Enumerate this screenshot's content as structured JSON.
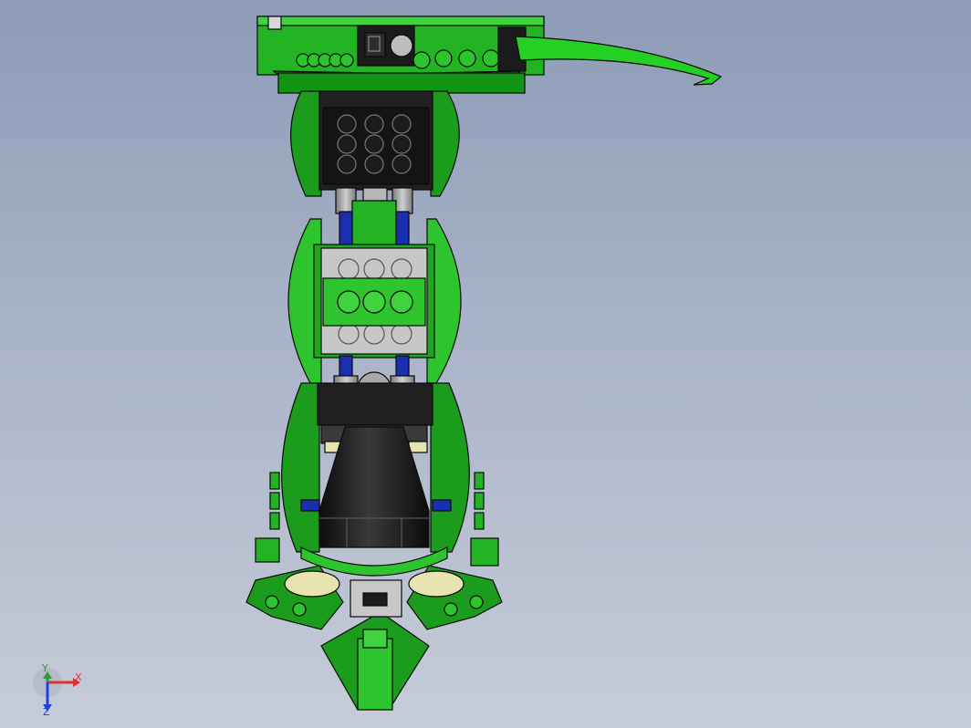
{
  "scene": {
    "view": "cad-3d-model-viewport",
    "subject": "lego-green-insect-creature",
    "colors": {
      "background_top": "#8d9bb6",
      "background_bottom": "#c6ccd8",
      "green": "#22b422",
      "green_light": "#3fd43f",
      "green_dark": "#0f6a0f",
      "black": "#1b1b1b",
      "gray": "#9c9c9c",
      "gray_light": "#c8c8c8",
      "blue": "#1a2fb0",
      "cream": "#e8e4b0",
      "edge": "#0a0a0a"
    }
  },
  "triad": {
    "x_label": "X",
    "y_label": "Y",
    "z_label": "Z",
    "x_color": "#e03030",
    "y_color": "#2aa02a",
    "z_color": "#2040e0"
  }
}
